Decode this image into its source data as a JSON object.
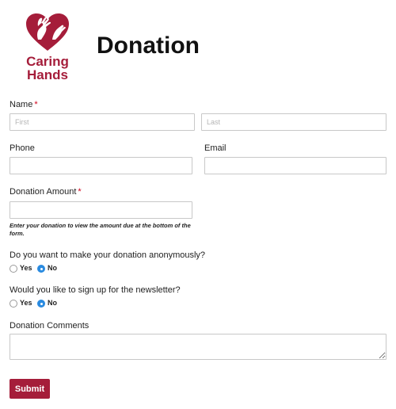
{
  "header": {
    "logo": {
      "line1": "Caring",
      "line2": "Hands"
    },
    "title": "Donation"
  },
  "colors": {
    "brand": "#a51d3a",
    "required": "#d0021b",
    "radio_selected": "#2b8be0"
  },
  "form": {
    "name": {
      "label": "Name",
      "required_mark": "*",
      "first_placeholder": "First",
      "last_placeholder": "Last"
    },
    "phone": {
      "label": "Phone",
      "value": ""
    },
    "email": {
      "label": "Email",
      "value": ""
    },
    "amount": {
      "label": "Donation Amount",
      "required_mark": "*",
      "value": "",
      "help": "Enter your donation to view the amount due at the bottom of the form."
    },
    "anonymous": {
      "question": "Do you want to make your donation anonymously?",
      "options": [
        {
          "label": "Yes",
          "checked": false
        },
        {
          "label": "No",
          "checked": true
        }
      ]
    },
    "newsletter": {
      "question": "Would you like to sign up for the newsletter?",
      "options": [
        {
          "label": "Yes",
          "checked": false
        },
        {
          "label": "No",
          "checked": true
        }
      ]
    },
    "comments": {
      "label": "Donation Comments",
      "value": ""
    },
    "submit_label": "Submit"
  }
}
